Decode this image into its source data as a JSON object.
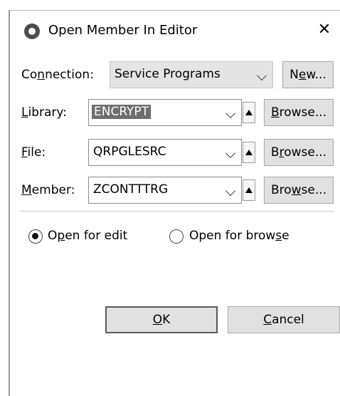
{
  "dialog": {
    "title": "Open Member In Editor",
    "close_glyph": "✕"
  },
  "connection": {
    "label_pre": "Co",
    "label_mn": "n",
    "label_post": "nection:",
    "value": "Service Programs",
    "new_pre": "N",
    "new_mn": "e",
    "new_post": "w..."
  },
  "library": {
    "label_pre": "",
    "label_mn": "L",
    "label_post": "ibrary:",
    "value": "ENCRYPT",
    "browse_pre": "",
    "browse_mn": "B",
    "browse_post": "rowse..."
  },
  "file": {
    "label_pre": "",
    "label_mn": "F",
    "label_post": "ile:",
    "value": "QRPGLESRC",
    "browse_pre": "B",
    "browse_mn": "r",
    "browse_post": "owse..."
  },
  "member": {
    "label_pre": "",
    "label_mn": "M",
    "label_post": "ember:",
    "value": "ZCONTTTRG",
    "browse_pre": "Bro",
    "browse_mn": "w",
    "browse_post": "se..."
  },
  "mode": {
    "edit_pre": "O",
    "edit_mn": "p",
    "edit_post": "en for edit",
    "browse_pre": "Open for brow",
    "browse_mn": "s",
    "browse_post": "e",
    "selected": "edit"
  },
  "buttons": {
    "ok_pre": "",
    "ok_mn": "O",
    "ok_post": "K",
    "cancel_pre": "",
    "cancel_mn": "C",
    "cancel_post": "ancel"
  }
}
